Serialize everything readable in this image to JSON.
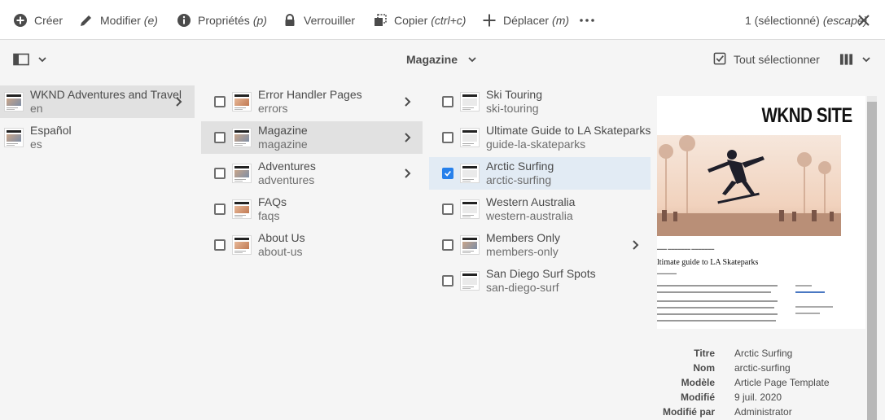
{
  "actionbar": {
    "create": {
      "label": "Créer",
      "shortcut": ""
    },
    "modify": {
      "label": "Modifier",
      "shortcut": "(e)"
    },
    "properties": {
      "label": "Propriétés",
      "shortcut": "(p)"
    },
    "lock": {
      "label": "Verrouiller",
      "shortcut": ""
    },
    "copy": {
      "label": "Copier",
      "shortcut": "(ctrl+c)"
    },
    "move": {
      "label": "Déplacer",
      "shortcut": "(m)"
    },
    "more_icon": "more-icon",
    "selection_count": "1 (sélectionné)",
    "escape_hint": "(escape)",
    "close_icon": "close-icon"
  },
  "headerbar": {
    "rail_toggle_icon": "rail-toggle-icon",
    "title": "Magazine",
    "select_all": "Tout sélectionner",
    "view_icon": "column-view-icon"
  },
  "columns": {
    "col1": [
      {
        "title": "WKND Adventures and Travel",
        "name": "en",
        "active": true,
        "has_children": true
      },
      {
        "title": "Español",
        "name": "es",
        "active": false,
        "has_children": false
      }
    ],
    "col2": [
      {
        "title": "Error Handler Pages",
        "name": "errors",
        "has_children": true,
        "checked": false
      },
      {
        "title": "Magazine",
        "name": "magazine",
        "has_children": true,
        "checked": false,
        "active": true
      },
      {
        "title": "Adventures",
        "name": "adventures",
        "has_children": true,
        "checked": false
      },
      {
        "title": "FAQs",
        "name": "faqs",
        "has_children": false,
        "checked": false
      },
      {
        "title": "About Us",
        "name": "about-us",
        "has_children": false,
        "checked": false
      }
    ],
    "col3": [
      {
        "title": "Ski Touring",
        "name": "ski-touring",
        "has_children": false,
        "checked": false
      },
      {
        "title": "Ultimate Guide to LA Skateparks",
        "name": "guide-la-skateparks",
        "has_children": false,
        "checked": false
      },
      {
        "title": "Arctic Surfing",
        "name": "arctic-surfing",
        "has_children": false,
        "checked": true
      },
      {
        "title": "Western Australia",
        "name": "western-australia",
        "has_children": false,
        "checked": false
      },
      {
        "title": "Members Only",
        "name": "members-only",
        "has_children": true,
        "checked": false
      },
      {
        "title": "San Diego Surf Spots",
        "name": "san-diego-surf",
        "has_children": false,
        "checked": false
      }
    ]
  },
  "preview": {
    "site_logo": "WKND SITE",
    "article_heading": "ltimate guide to LA Skateparks"
  },
  "meta": [
    {
      "key": "Titre",
      "value": "Arctic Surfing"
    },
    {
      "key": "Nom",
      "value": "arctic-surfing"
    },
    {
      "key": "Modèle",
      "value": "Article Page Template"
    },
    {
      "key": "Modifié",
      "value": "9 juil. 2020"
    },
    {
      "key": "Modifié par",
      "value": "Administrator"
    }
  ],
  "colors": {
    "accent": "#2680eb",
    "active_row": "#e1e1e1",
    "selected_row": "#e2ebf4"
  }
}
